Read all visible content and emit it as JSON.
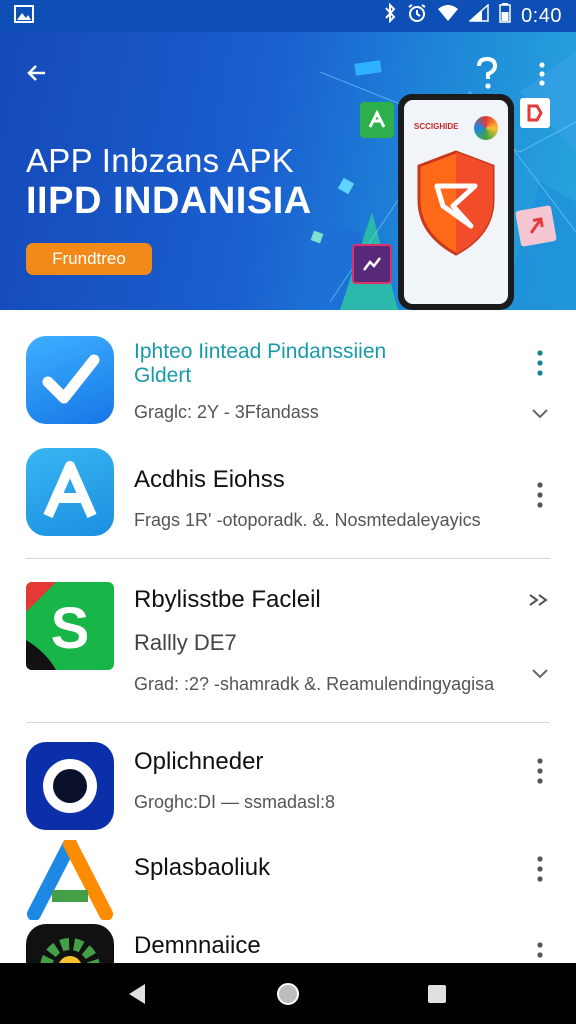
{
  "status_bar": {
    "time": "0:40"
  },
  "hero": {
    "title_line1": "APP Inbzans APK",
    "title_line2": "IIPD INDANISIA",
    "button_label": "Frundtreo",
    "phone_screen_label": "SCCIGHIDE",
    "colors": {
      "gradient_start": "#1549b8",
      "gradient_end": "#27a7dc",
      "button": "#f28a1a"
    }
  },
  "apps": [
    {
      "name_line1": "Iphteo Iintead Pindanssiien",
      "name_line2": "Gldert",
      "meta": "Graglc: 2Y - 3Ffandass",
      "icon": "blue-checkmark-icon"
    },
    {
      "name": "Acdhis Eiohss",
      "meta": "Frags 1R' -otoporadk. &. Nosmtedaleyayics",
      "icon": "letter-a-icon"
    },
    {
      "name": "Rbylisstbe Facleil",
      "sub": "Rallly DE7",
      "meta": "Grad: :2? -shamradk &. Reamulendingyagisa",
      "icon": "dollar-s-icon"
    },
    {
      "name": "Oplichneder",
      "meta": "Groghc:DI — ssmadasl:8",
      "icon": "eye-icon"
    },
    {
      "name": "Splasbaoliuk",
      "icon": "triangle-a-icon"
    },
    {
      "name": "Demnnaiice",
      "icon": "gear-icon"
    }
  ]
}
